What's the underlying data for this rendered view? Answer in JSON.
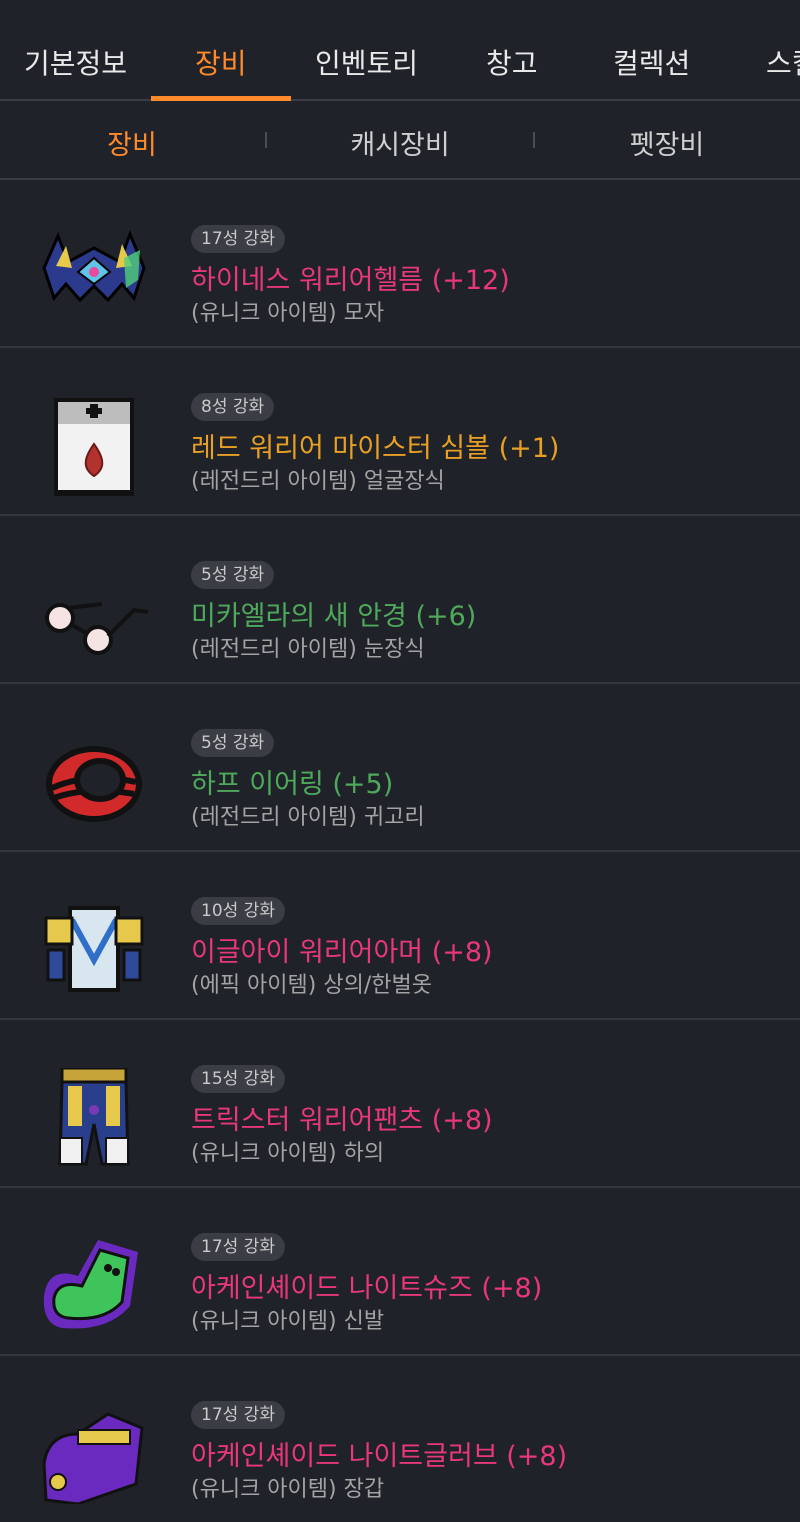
{
  "nav": {
    "tabs": [
      "기본정보",
      "장비",
      "인벤토리",
      "창고",
      "컬렉션",
      "스킬"
    ],
    "active_index": 1
  },
  "subnav": {
    "tabs": [
      "장비",
      "캐시장비",
      "펫장비"
    ],
    "active_index": 0
  },
  "colors": {
    "accent": "#ff8a2b",
    "unique": "#e8377a",
    "legendary": "#4fa95b",
    "legendary_gold": "#e8a024",
    "epic": "#e8377a"
  },
  "items": [
    {
      "stars": "17성 강화",
      "name": "하이네스 워리어헬름 (+12)",
      "detail": "(유니크 아이템) 모자",
      "color": "pink",
      "icon": "helmet-icon"
    },
    {
      "stars": "8성 강화",
      "name": "레드 워리어 마이스터 심볼 (+1)",
      "detail": "(레전드리 아이템) 얼굴장식",
      "color": "gold",
      "icon": "symbol-card-icon"
    },
    {
      "stars": "5성 강화",
      "name": "미카엘라의 새 안경 (+6)",
      "detail": "(레전드리 아이템) 눈장식",
      "color": "green",
      "icon": "glasses-icon"
    },
    {
      "stars": "5성 강화",
      "name": "하프 이어링 (+5)",
      "detail": "(레전드리 아이템) 귀고리",
      "color": "green",
      "icon": "earring-icon"
    },
    {
      "stars": "10성 강화",
      "name": "이글아이 워리어아머 (+8)",
      "detail": "(에픽 아이템) 상의/한벌옷",
      "color": "pink",
      "icon": "armor-icon"
    },
    {
      "stars": "15성 강화",
      "name": "트릭스터 워리어팬츠 (+8)",
      "detail": "(유니크 아이템) 하의",
      "color": "pink",
      "icon": "pants-icon"
    },
    {
      "stars": "17성 강화",
      "name": "아케인셰이드 나이트슈즈 (+8)",
      "detail": "(유니크 아이템) 신발",
      "color": "pink",
      "icon": "shoes-icon"
    },
    {
      "stars": "17성 강화",
      "name": "아케인셰이드 나이트글러브 (+8)",
      "detail": "(유니크 아이템) 장갑",
      "color": "pink",
      "icon": "glove-icon"
    }
  ]
}
